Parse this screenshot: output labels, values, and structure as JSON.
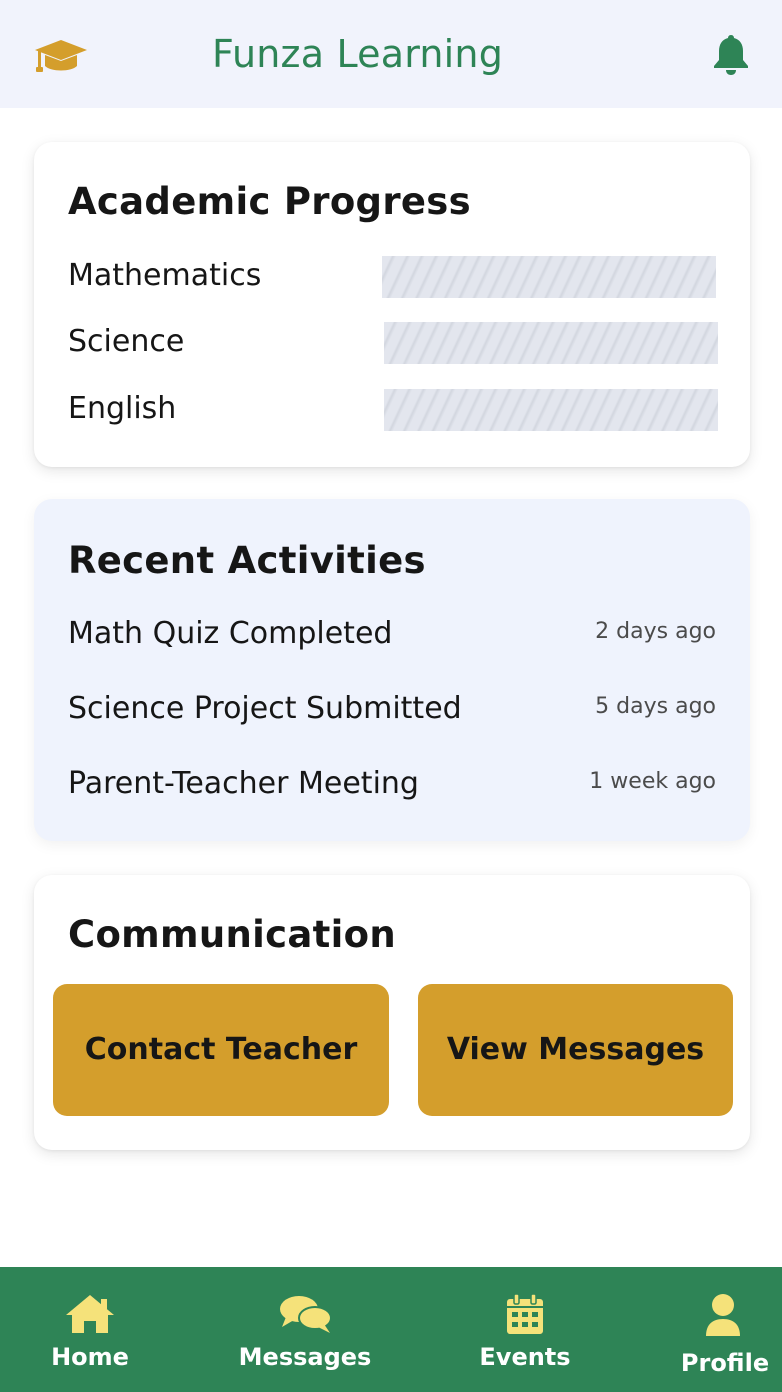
{
  "header": {
    "title": "Funza Learning",
    "logo_icon": "graduation-cap-icon",
    "notification_icon": "bell-icon"
  },
  "academic_progress": {
    "title": "Academic Progress",
    "subjects": [
      {
        "name": "Mathematics"
      },
      {
        "name": "Science"
      },
      {
        "name": "English"
      }
    ]
  },
  "recent_activities": {
    "title": "Recent Activities",
    "items": [
      {
        "label": "Math Quiz Completed",
        "time": "2 days ago"
      },
      {
        "label": "Science Project Submitted",
        "time": "5 days ago"
      },
      {
        "label": "Parent-Teacher Meeting",
        "time": "1 week ago"
      }
    ]
  },
  "communication": {
    "title": "Communication",
    "contact_label": "Contact Teacher",
    "messages_label": "View Messages"
  },
  "bottom_nav": {
    "items": [
      {
        "label": "Home",
        "icon": "home-icon"
      },
      {
        "label": "Messages",
        "icon": "chat-bubbles-icon"
      },
      {
        "label": "Events",
        "icon": "calendar-icon"
      },
      {
        "label": "Profile",
        "icon": "user-icon"
      }
    ]
  },
  "colors": {
    "brand_green": "#2e8456",
    "accent_gold": "#d49e2c",
    "nav_icon_yellow": "#f5e27a",
    "header_bg": "#f1f3fc",
    "tint_card_bg": "#eff3fd"
  }
}
